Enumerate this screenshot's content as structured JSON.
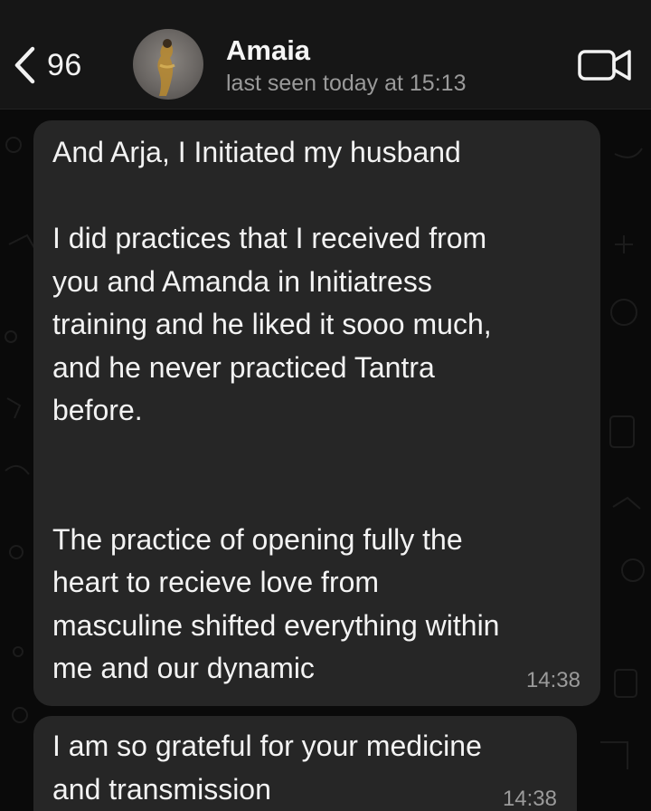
{
  "header": {
    "back_count": "96",
    "contact_name": "Amaia",
    "last_seen": "last seen today at 15:13",
    "icons": [
      "chevron-left-icon",
      "video-camera-icon"
    ]
  },
  "messages": [
    {
      "text": "And Arja, I Initiated my husband\n\nI did practices that I received from\nyou and Amanda in Initiatress\ntraining and he liked it sooo much,\nand he never practiced Tantra\nbefore.\n\n\nThe practice of opening fully the\nheart to recieve love from\nmasculine shifted everything within\nme and our dynamic",
      "time": "14:38"
    },
    {
      "text": "I am so grateful for your medicine\nand transmission",
      "time": "14:38"
    }
  ],
  "colors": {
    "header_bg": "#161616",
    "bubble_bg": "#262626",
    "chat_bg": "#0a0a0a",
    "meta_text": "#9a9a9a"
  }
}
